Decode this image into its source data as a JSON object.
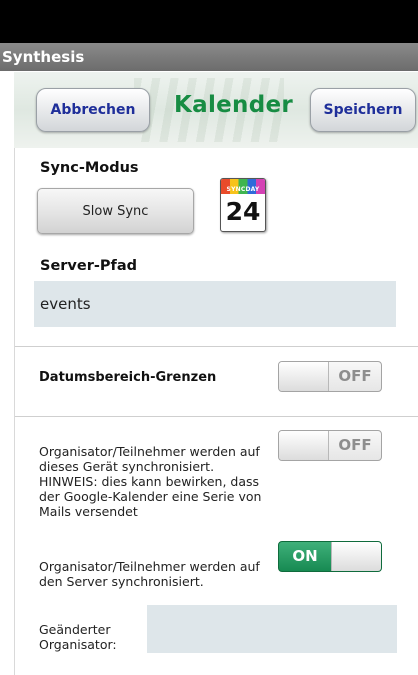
{
  "app": {
    "title": "Synthesis"
  },
  "header": {
    "cancel_label": "Abbrechen",
    "title": "Kalender",
    "save_label": "Speichern"
  },
  "sync": {
    "label": "Sync-Modus",
    "mode_value": "Slow Sync",
    "calendar_icon": {
      "brand": "SYNCDAY",
      "day": "24",
      "name": "calendar-icon"
    }
  },
  "server_path": {
    "label": "Server-Pfad",
    "value": "events"
  },
  "date_range": {
    "label": "Datumsbereich-Grenzen",
    "toggle": "OFF"
  },
  "organizer_device": {
    "text": "Organisator/Teilnehmer werden auf dieses Gerät synchronisiert. HINWEIS: dies kann bewirken, dass der Google-Kalender eine Serie von Mails versendet",
    "toggle": "OFF"
  },
  "organizer_server": {
    "text": "Organisator/Teilnehmer werden auf den Server synchronisiert.",
    "toggle": "ON"
  },
  "changed_organizer": {
    "label": "Geänderter Organisator:",
    "value": ""
  },
  "colors": {
    "title_green": "#178c43",
    "button_text_blue": "#1f2f9a",
    "field_bg": "#dee6ea",
    "toggle_on": "#178a52"
  }
}
